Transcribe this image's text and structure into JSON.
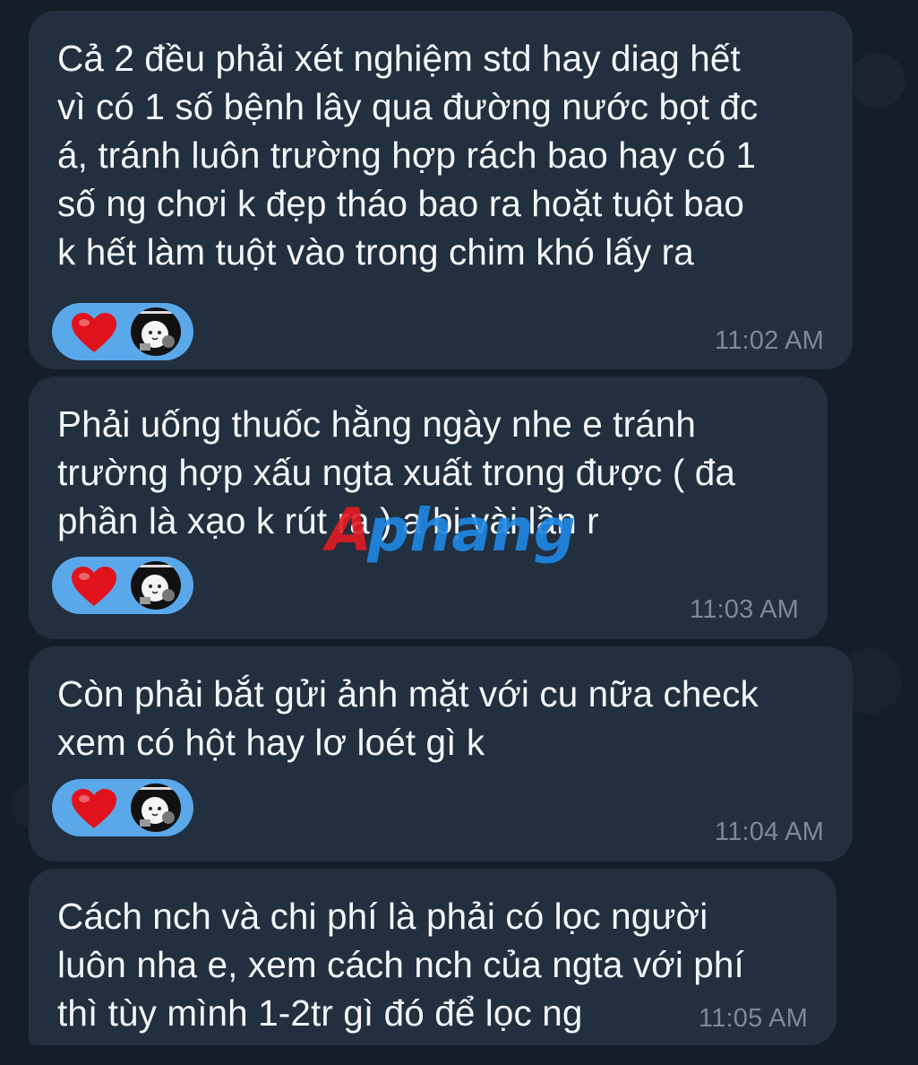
{
  "messages": [
    {
      "text": "Cả 2 đều phải xét nghiệm std hay diag hết\nvì có 1 số bệnh lây qua đường nước bọt đc\ná, tránh luôn trường hợp rách bao hay có 1\nsố ng chơi k đẹp tháo bao ra hoặt tuột bao\nk hết làm tuột vào trong chim khó lấy ra",
      "time": "11:02 AM",
      "reactions": [
        "red-heart",
        "sticker-avatar"
      ]
    },
    {
      "text": "Phải uống thuốc hằng ngày nhe e tránh\ntrường hợp xấu ngta xuất trong được ( đa\nphần là xạo k rút ra ) a bị vài lần r",
      "time": "11:03 AM",
      "reactions": [
        "red-heart",
        "sticker-avatar"
      ]
    },
    {
      "text": "Còn phải bắt gửi ảnh mặt với cu nữa check\nxem có hột hay lơ loét gì k",
      "time": "11:04 AM",
      "reactions": [
        "red-heart",
        "sticker-avatar"
      ]
    },
    {
      "text": "Cách nch và chi phí là phải có lọc người\nluôn nha e, xem cách nch của ngta với phí\nthì tùy mình 1-2tr gì đó để lọc ng",
      "time": "11:05 AM",
      "reactions": []
    }
  ],
  "watermark": {
    "text": "Aphang",
    "colors": {
      "first": "#e31b23",
      "rest": "#1e88e5"
    }
  },
  "colors": {
    "background": "#141e28",
    "bubble": "#212f3e",
    "reaction_pill": "#5aa8ea",
    "heart": "#e0131d",
    "text": "#f3f6f9",
    "timestamp": "#7c8a98"
  }
}
